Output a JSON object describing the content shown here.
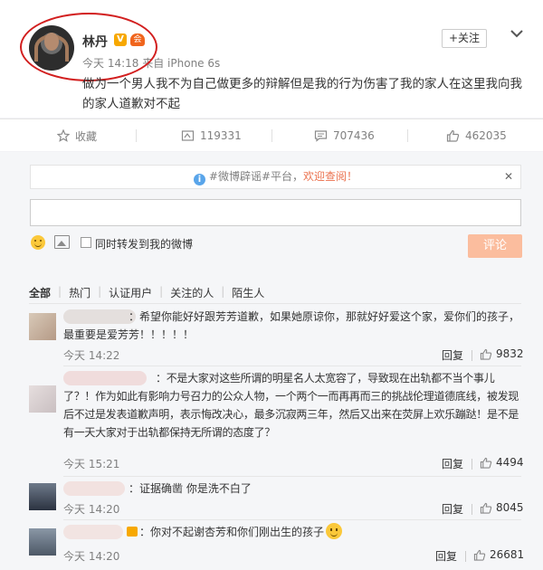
{
  "post": {
    "author": "林丹",
    "verified_badge": "V",
    "vip_badge": "会",
    "time": "今天 14:18",
    "source": "来自 iPhone 6s",
    "follow_label": "+关注",
    "content": "做为一个男人我不为自己做更多的辩解但是我的行为伤害了我的家人在这里我向我的家人道歉对不起",
    "highlight_color": "#d21f1f"
  },
  "actions": {
    "favorite": "收藏",
    "repost": "119331",
    "comment": "707436",
    "like": "462035"
  },
  "comment_box": {
    "notice_prefix": "#微博辟谣#平台，",
    "notice_link": "欢迎查阅！",
    "notice_close": "✕",
    "repost_label": "同时转发到我的微博",
    "submit_label": "评论",
    "submit_color": "#fbbd9e"
  },
  "filters": [
    "全部",
    "热门",
    "认证用户",
    "关注的人",
    "陌生人"
  ],
  "comments": [
    {
      "text": "：希望你能好好跟芳芳道歉，如果她原谅你，那就好好爱这个家，爱你们的孩子，最重要是爱芳芳！！！！！",
      "time": "今天 14:22",
      "reply": "回复",
      "likes": "9832"
    },
    {
      "text": "：不是大家对这些所谓的明星名人太宽容了，导致现在出轨都不当个事儿了？！作为如此有影响力号召力的公众人物，一个两个一而再再而三的挑战伦理道德底线，被发现后不过是发表道歉声明，表示悔改决心，最多沉寂两三年，然后又出来在荧屏上欢乐蹦跶！是不是有一天大家对于出轨都保持无所谓的态度了？",
      "time": "今天 15:21",
      "reply": "回复",
      "likes": "4494"
    },
    {
      "text": "：证据确凿  你是洗不白了",
      "time": "今天 14:20",
      "reply": "回复",
      "likes": "8045"
    },
    {
      "text": "：你对不起谢杏芳和你们刚出生的孩子",
      "time": "今天 14:20",
      "reply": "回复",
      "likes": "26681"
    }
  ]
}
